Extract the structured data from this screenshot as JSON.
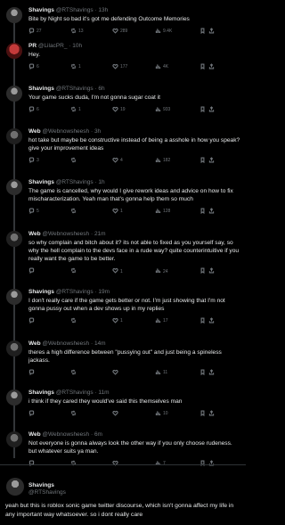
{
  "tweets": [
    {
      "name": "Shavings",
      "handle": "@RTShavings",
      "time": "13h",
      "text": "Bite by Night so bad it's got me defending Outcome Memories",
      "replies": "27",
      "retweets": "13",
      "likes": "289",
      "views": "9.4K"
    },
    {
      "name": "PR",
      "handle": "@LilacPR_",
      "time": "10h",
      "text": "Hey.",
      "replies": "6",
      "retweets": "1",
      "likes": "177",
      "views": "4K"
    },
    {
      "name": "Shavings",
      "handle": "@RTShavings",
      "time": "6h",
      "text": "Your game sucks duda, I'm not gonna sugar coat it",
      "replies": "6",
      "retweets": "1",
      "likes": "19",
      "views": "933"
    },
    {
      "name": "Web",
      "handle": "@Webnowsheesh",
      "time": "3h",
      "text": "hot take but maybe be constructive instead of being a asshole in how you speak? give your improvement ideas",
      "replies": "3",
      "retweets": "",
      "likes": "4",
      "views": "182"
    },
    {
      "name": "Shavings",
      "handle": "@RTShavings",
      "time": "1h",
      "text": "The game is cancelled, why would I give rework ideas and advice on how to fix mischaracterization. Yeah man that's gonna help them so much",
      "replies": "5",
      "retweets": "",
      "likes": "1",
      "views": "128"
    },
    {
      "name": "Web",
      "handle": "@Webnowsheesh",
      "time": "21m",
      "text": "so why complain and bitch about it? its not able to fixed as you yourself say, so why the hell complain to the devs face in a rude way? quite counterintuitive if you really want the game to be better.",
      "replies": "",
      "retweets": "",
      "likes": "1",
      "views": "24"
    },
    {
      "name": "Shavings",
      "handle": "@RTShavings",
      "time": "19m",
      "text": "I don't really care if the game gets better or not. I'm just showing that I'm not gonna pussy out when a dev shows up in my replies",
      "replies": "",
      "retweets": "",
      "likes": "1",
      "views": "17"
    },
    {
      "name": "Web",
      "handle": "@Webnowsheesh",
      "time": "14m",
      "text": "theres a high difference between \"pussying out\" and just being a spineless jackass.",
      "replies": "",
      "retweets": "",
      "likes": "",
      "views": "11"
    },
    {
      "name": "Shavings",
      "handle": "@RTShavings",
      "time": "11m",
      "text": "i think if they cared they would've said this themselves man",
      "replies": "",
      "retweets": "",
      "likes": "",
      "views": "10"
    },
    {
      "name": "Web",
      "handle": "@Webnowsheesh",
      "time": "6m",
      "text": "Not everyone is gonna always look the other way if you only choose rudeness. but whatever suits ya man.",
      "replies": "",
      "retweets": "",
      "likes": "",
      "views": "7"
    }
  ],
  "final": {
    "name": "Shavings",
    "handle": "@RTShavings",
    "text": "yeah but this is roblox sonic game twitter discourse, which isn't gonna affect my life in any important way whatsoever. so i dont really care"
  },
  "icons": {
    "reply": "reply-icon",
    "retweet": "retweet-icon",
    "like": "heart-icon",
    "views": "views-icon",
    "bookmark": "bookmark-icon",
    "share": "share-icon"
  }
}
